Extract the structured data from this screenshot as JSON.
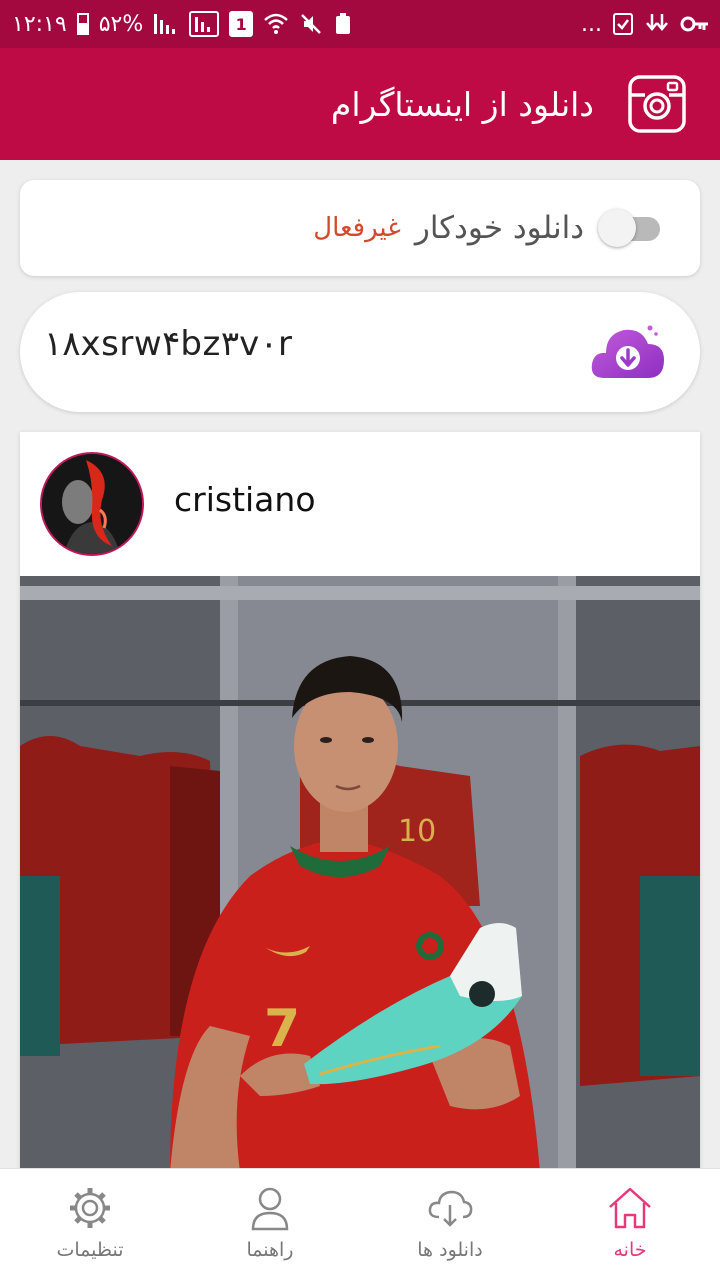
{
  "status_bar": {
    "time": "۱۲:۱۹",
    "battery_percent": "۵۲%",
    "sim_badge": "1",
    "more": "..."
  },
  "app_bar": {
    "title": "دانلود از اینستاگرام",
    "icon": "instagram-icon"
  },
  "auto_download": {
    "label": "دانلود خودکار",
    "status": "غیرفعال",
    "enabled": false
  },
  "code_input": {
    "value": "۱۸xsrw۴bz۳v۰r",
    "icon": "cloud-download-icon"
  },
  "post": {
    "username": "cristiano"
  },
  "bottom_nav": {
    "items": [
      {
        "label": "تنظیمات",
        "icon": "gear-icon",
        "active": false
      },
      {
        "label": "راهنما",
        "icon": "user-icon",
        "active": false
      },
      {
        "label": "دانلود ها",
        "icon": "cloud-download-icon",
        "active": false
      },
      {
        "label": "خانه",
        "icon": "home-icon",
        "active": true
      }
    ]
  },
  "colors": {
    "status_bar": "#a3083e",
    "app_bar": "#be0a45",
    "accent": "#e5397a",
    "inactive_status": "#d24a2b"
  }
}
